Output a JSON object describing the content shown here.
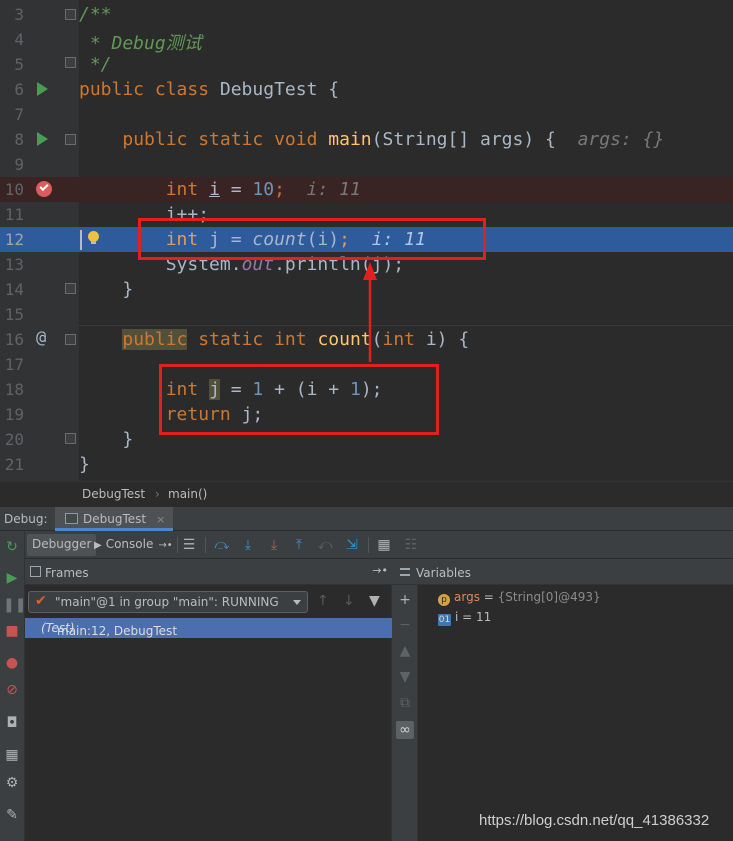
{
  "editor": {
    "lines": [
      {
        "num": "3"
      },
      {
        "num": "4"
      },
      {
        "num": "5"
      },
      {
        "num": "6"
      },
      {
        "num": "7"
      },
      {
        "num": "8"
      },
      {
        "num": "9"
      },
      {
        "num": "10"
      },
      {
        "num": "11"
      },
      {
        "num": "12"
      },
      {
        "num": "13"
      },
      {
        "num": "14"
      },
      {
        "num": "15"
      },
      {
        "num": "16"
      },
      {
        "num": "17"
      },
      {
        "num": "18"
      },
      {
        "num": "19"
      },
      {
        "num": "20"
      },
      {
        "num": "21"
      }
    ],
    "tokens": {
      "l3": "/**",
      "l4": " * Debug测试",
      "l5": " */",
      "l6_kw": "public class",
      "l6_rest": " DebugTest {",
      "l8_kw": "public static void",
      "l8_fn": "main",
      "l8_rest": "(String[] args) {",
      "l8_inline": "args: {}",
      "l10_kw": "int",
      "l10_var": "i",
      "l10_eq": " = ",
      "l10_num": "10",
      "l10_semi": ";",
      "l10_inline": "i: 11",
      "l11": "i++;",
      "l12_kw": "int",
      "l12_mid": " j = ",
      "l12_fn": "count",
      "l12_arg": "(i)",
      "l12_semi": ";",
      "l12_inline": "i: 11",
      "l13_a": "System.",
      "l13_out": "out",
      "l13_b": ".println(j);",
      "l14": "}",
      "l16_kw1": "public",
      "l16_kw2": "static int",
      "l16_fn": "count",
      "l16_p1": "(",
      "l16_kw3": "int",
      "l16_p2": " i) {",
      "l18_kw": "int",
      "l18_var": "j",
      "l18_a": " = ",
      "l18_n1": "1",
      "l18_b": " + (i + ",
      "l18_n2": "1",
      "l18_c": ");",
      "l19_kw": "return",
      "l19_rest": " j;",
      "l20": "}",
      "l21": "}"
    },
    "gutter_icons": [
      "run-icon",
      "fold-icon",
      "breakpoint-icon",
      "bulb-icon",
      "implements-icon"
    ]
  },
  "breadcrumb": {
    "class": "DebugTest",
    "separator": "›",
    "method": "main()"
  },
  "debug": {
    "label": "Debug:",
    "tab": "DebugTest",
    "tab_close": "×",
    "toolbar": {
      "debugger_tab": "Debugger",
      "console_tab": "Console"
    },
    "frames": {
      "title": "Frames",
      "thread": "\"main\"@1 in group \"main\": RUNNING",
      "frame_main": "main:12, DebugTest",
      "frame_class": "(Test)"
    },
    "variables": {
      "title": "Variables",
      "items": [
        {
          "badge": "p",
          "name": "args",
          "eq": " = ",
          "value": "{String[0]@493}"
        },
        {
          "badge": "01",
          "name": "i",
          "eq": " = ",
          "value": "11"
        }
      ]
    }
  },
  "watermark": "https://blog.csdn.net/qq_41386332",
  "colors": {
    "keyword": "#cc7832",
    "number": "#6897bb",
    "comment": "#629755",
    "function": "#ffc66d",
    "exec_line": "#2d5b9b",
    "breakpoint": "#db5c5c",
    "annotation_box": "#e2201d"
  }
}
